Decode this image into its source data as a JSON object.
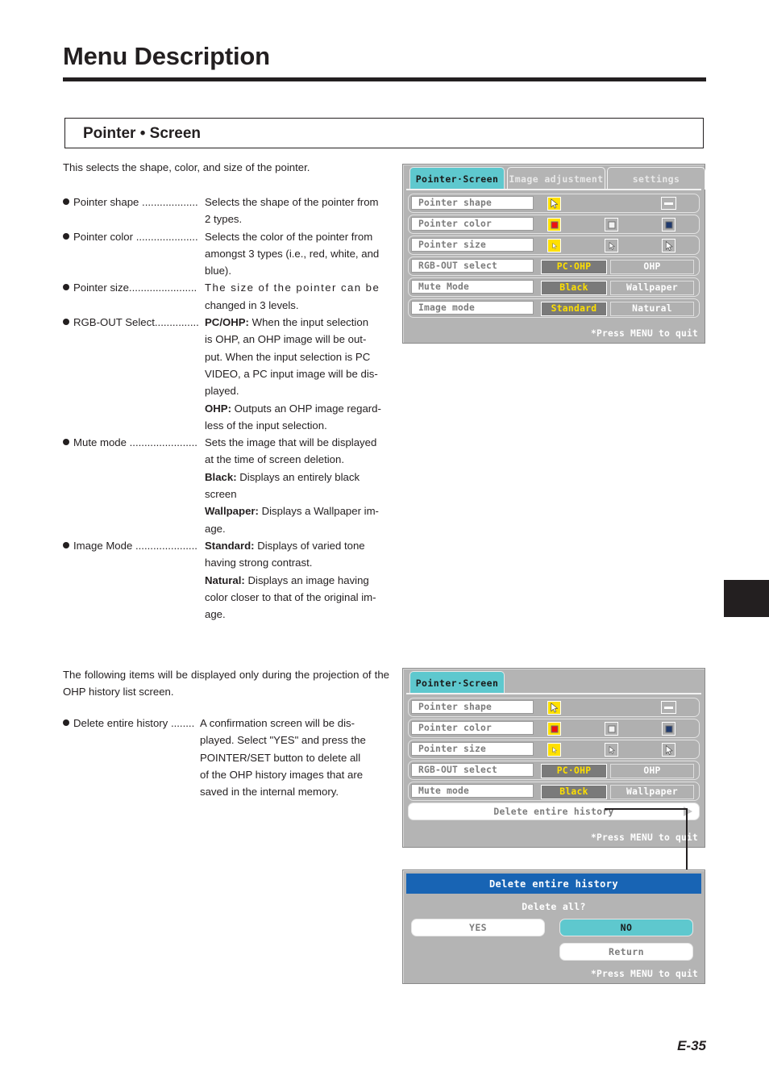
{
  "header": {
    "chapter_title": "Menu Description",
    "section_title": "Pointer • Screen"
  },
  "intro": "This selects the shape, color, and size of the pointer.",
  "definitions": [
    {
      "term": "Pointer shape ...................",
      "desc_html": "Selects the shape of the pointer from",
      "cont_html": [
        "2 types."
      ]
    },
    {
      "term": "Pointer color .....................",
      "desc_html": "Selects the color of the pointer from",
      "cont_html": [
        "amongst 3 types (i.e., red, white, and",
        "blue)."
      ]
    },
    {
      "term": "Pointer size.......................",
      "desc_html": "The size of the pointer can be",
      "cont_html": [
        "changed in 3 levels."
      ]
    },
    {
      "term": "RGB-OUT Select...............",
      "desc_html": "<b>PC/OHP:</b> When the input selection",
      "cont_html": [
        "is OHP, an OHP image will be out-",
        "put. When the input selection is PC",
        "VIDEO, a PC input image will be dis-",
        "played.",
        "<b>OHP:</b> Outputs an OHP image regard-",
        "less of the input selection."
      ]
    },
    {
      "term": "Mute mode .......................",
      "desc_html": "Sets the image that will be displayed",
      "cont_html": [
        "at the time of screen deletion.",
        "<b>Black:</b> Displays an entirely black",
        "screen",
        "<b>Wallpaper:</b> Displays a Wallpaper im-",
        "age."
      ]
    },
    {
      "term": "Image Mode .....................",
      "desc_html": "<b>Standard:</b> Displays of varied tone",
      "cont_html": [
        "having strong contrast.",
        "<b>Natural:</b> Displays an image having",
        "color closer to that of the original im-",
        "age."
      ]
    }
  ],
  "paragraph2": "The following items will be displayed only during the projection of the OHP history list screen.",
  "definitions2": [
    {
      "term": "Delete entire history ........",
      "desc_html": "A confirmation screen will be dis-",
      "cont_html": [
        "played. Select \"YES\" and press the",
        "POINTER/SET button to delete all",
        "of the OHP history images that are",
        "saved in the internal memory."
      ]
    }
  ],
  "page_number": "E-35",
  "colors": {
    "active_tab": "#5ec8ce",
    "selected_option_bg": "#7a7a7a",
    "selected_option_text": "#ffe000",
    "osd_background": "#b4b4b4",
    "dialog_titlebar": "#1864b4",
    "pointer_red": "#ee1111",
    "pointer_white": "#f2f2f2",
    "pointer_blue": "#1f3a6e",
    "swatch_highlight": "#ffe000",
    "thumb_tab": "#231f20"
  },
  "osd1": {
    "tabs": [
      {
        "label": "Pointer·Screen",
        "active": true
      },
      {
        "label": "Image adjustment",
        "active": false
      },
      {
        "label": "settings",
        "active": false
      }
    ],
    "rows": [
      {
        "label": "Pointer shape",
        "kind": "icons",
        "options": [
          {
            "icon": "cursor-arrow-icon",
            "selected": true
          },
          {
            "icon": "dash-bar-icon",
            "selected": false
          }
        ]
      },
      {
        "label": "Pointer color",
        "kind": "colors",
        "options": [
          {
            "icon": "color-swatch-red-icon",
            "color": "#ee1111",
            "selected": true
          },
          {
            "icon": "color-swatch-white-icon",
            "color": "#f2f2f2",
            "selected": false
          },
          {
            "icon": "color-swatch-blue-icon",
            "color": "#1f3a6e",
            "selected": false
          }
        ]
      },
      {
        "label": "Pointer size",
        "kind": "sizes",
        "options": [
          {
            "icon": "cursor-small-icon",
            "selected": true
          },
          {
            "icon": "cursor-medium-icon",
            "selected": false
          },
          {
            "icon": "cursor-large-icon",
            "selected": false
          }
        ]
      },
      {
        "label": "RGB-OUT select",
        "kind": "buttons",
        "options": [
          {
            "label": "PC·OHP",
            "selected": true
          },
          {
            "label": "OHP",
            "selected": false
          }
        ]
      },
      {
        "label": "Mute Mode",
        "kind": "buttons",
        "options": [
          {
            "label": "Black",
            "selected": true
          },
          {
            "label": "Wallpaper",
            "selected": false
          }
        ]
      },
      {
        "label": "Image mode",
        "kind": "buttons",
        "options": [
          {
            "label": "Standard",
            "selected": true
          },
          {
            "label": "Natural",
            "selected": false
          }
        ]
      }
    ],
    "footer": "*Press MENU to quit"
  },
  "osd2": {
    "tabs": [
      {
        "label": "Pointer·Screen",
        "active": true
      }
    ],
    "rows": [
      {
        "label": "Pointer shape",
        "kind": "icons",
        "options": [
          {
            "icon": "cursor-arrow-icon",
            "selected": true
          },
          {
            "icon": "dash-bar-icon",
            "selected": false
          }
        ]
      },
      {
        "label": "Pointer color",
        "kind": "colors",
        "options": [
          {
            "icon": "color-swatch-red-icon",
            "color": "#ee1111",
            "selected": true
          },
          {
            "icon": "color-swatch-white-icon",
            "color": "#f2f2f2",
            "selected": false
          },
          {
            "icon": "color-swatch-blue-icon",
            "color": "#1f3a6e",
            "selected": false
          }
        ]
      },
      {
        "label": "Pointer size",
        "kind": "sizes",
        "options": [
          {
            "icon": "cursor-small-icon",
            "selected": true
          },
          {
            "icon": "cursor-medium-icon",
            "selected": false
          },
          {
            "icon": "cursor-large-icon",
            "selected": false
          }
        ]
      },
      {
        "label": "RGB-OUT select",
        "kind": "buttons",
        "options": [
          {
            "label": "PC·OHP",
            "selected": true
          },
          {
            "label": "OHP",
            "selected": false
          }
        ]
      },
      {
        "label": "Mute mode",
        "kind": "buttons",
        "options": [
          {
            "label": "Black",
            "selected": true
          },
          {
            "label": "Wallpaper",
            "selected": false
          }
        ]
      }
    ],
    "history_row": "Delete entire history",
    "footer": "*Press MENU to quit"
  },
  "dialog": {
    "title": "Delete entire history",
    "question": "Delete all?",
    "buttons": [
      {
        "label": "YES",
        "highlighted": false
      },
      {
        "label": "NO",
        "highlighted": true
      },
      {
        "label": "Return",
        "highlighted": false
      }
    ],
    "footer": "*Press MENU to quit"
  }
}
